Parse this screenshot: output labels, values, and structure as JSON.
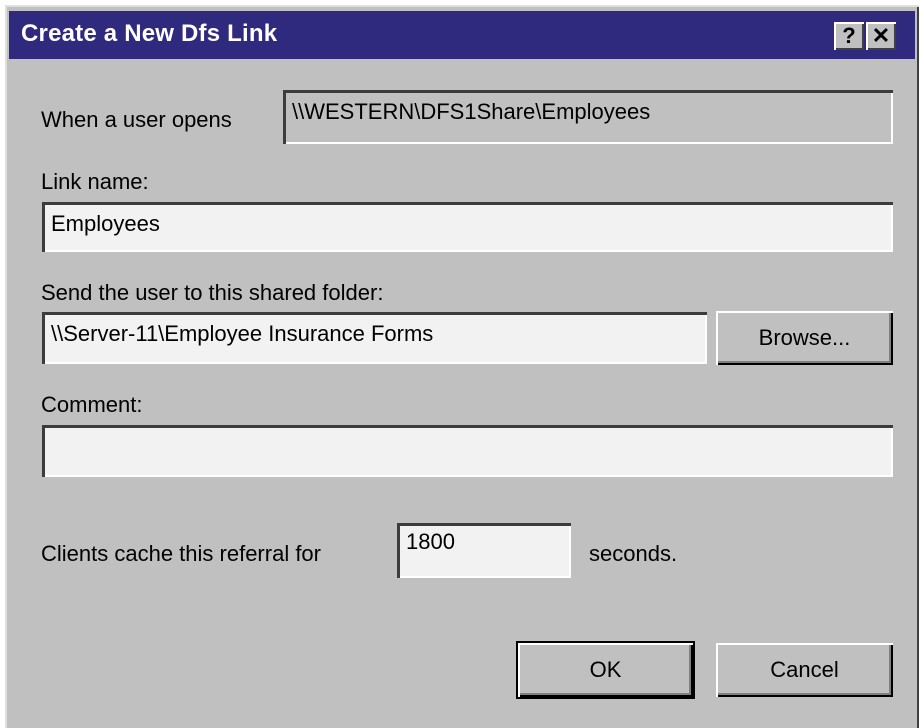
{
  "dialog": {
    "title": "Create a New Dfs Link",
    "help_glyph": "?",
    "close_glyph": "✕"
  },
  "form": {
    "when_user_opens_label": "When a user opens",
    "when_user_opens_value": "\\\\WESTERN\\DFS1Share\\Employees",
    "link_name_label": "Link name:",
    "link_name_value": "Employees",
    "shared_folder_label": "Send the user to this shared folder:",
    "shared_folder_value": "\\\\Server-11\\Employee Insurance Forms",
    "browse_label": "Browse...",
    "comment_label": "Comment:",
    "comment_value": "",
    "cache_label": "Clients cache this referral for",
    "cache_value": "1800",
    "cache_unit": "seconds."
  },
  "buttons": {
    "ok": "OK",
    "cancel": "Cancel"
  },
  "colors": {
    "titlebar": "#2f2a7e",
    "face": "#c0c0c0",
    "field": "#f2f2f2"
  }
}
